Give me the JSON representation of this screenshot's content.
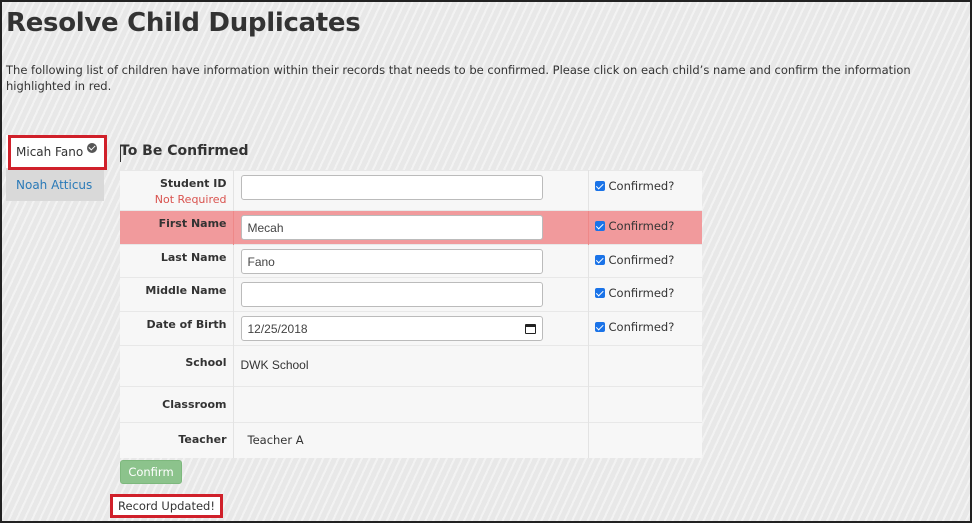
{
  "page": {
    "title": "Resolve Child Duplicates",
    "intro": "The following list of children have information within their records that needs to be confirmed. Please click on each child’s name and confirm the information highlighted in red."
  },
  "sidebar": {
    "items": [
      {
        "label": "Micah Fano",
        "active": true,
        "icon": "check-circle-icon"
      },
      {
        "label": "Noah Atticus",
        "active": false
      }
    ]
  },
  "panel": {
    "title": "To Be Confirmed",
    "confirmed_label": "Confirmed?",
    "fields": {
      "student_id": {
        "label": "Student ID",
        "sublabel": "Not Required",
        "value": "",
        "confirmed": true
      },
      "first_name": {
        "label": "First Name",
        "value": "Mecah",
        "confirmed": true,
        "highlighted": true
      },
      "last_name": {
        "label": "Last Name",
        "value": "Fano",
        "confirmed": true
      },
      "middle_name": {
        "label": "Middle Name",
        "value": "",
        "confirmed": true
      },
      "dob": {
        "label": "Date of Birth",
        "value": "12/25/2018",
        "confirmed": true
      },
      "school": {
        "label": "School",
        "value": "DWK School"
      },
      "classroom": {
        "label": "Classroom",
        "value": ""
      },
      "teacher": {
        "label": "Teacher",
        "value": "Teacher A"
      }
    },
    "confirm_button": "Confirm",
    "status": "Record Updated!"
  },
  "colors": {
    "highlight_row": "#f19a9c",
    "link": "#2a7ab8",
    "annotation_box": "#d0202a",
    "confirm_button": "#8cc38c"
  }
}
